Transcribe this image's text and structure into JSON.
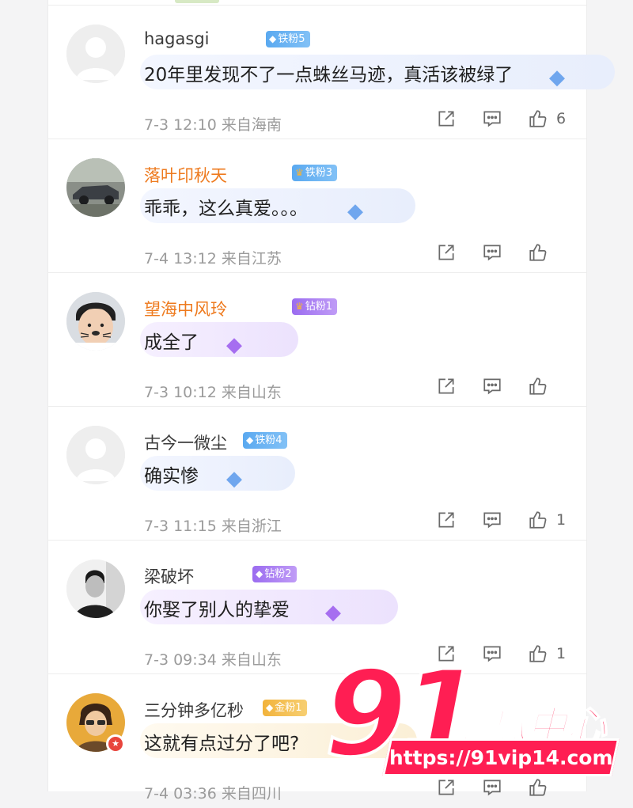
{
  "comments": [
    {
      "username": "hagasgi",
      "badge": {
        "label": "铁粉5",
        "style": "blue",
        "gem": "◆"
      },
      "text": "20年里发现不了一点蛛丝马迹，真活该被绿了",
      "meta": "7-3 12:10  来自海南",
      "likes": "6",
      "avatar": "default-avatar",
      "name_color": "#3a3a3a",
      "bubble_style": "blue"
    },
    {
      "username": "落叶印秋天",
      "badge": {
        "label": "铁粉3",
        "style": "blue",
        "gem": "♛"
      },
      "text": "乖乖，这么真爱。。。",
      "meta": "7-4 13:12  来自江苏",
      "likes": "",
      "avatar": "car-avatar",
      "name_color": "#ee7a1e",
      "bubble_style": "blue"
    },
    {
      "username": "望海中风玲",
      "badge": {
        "label": "钻粉1",
        "style": "purple",
        "gem": "♛"
      },
      "text": "成全了",
      "meta": "7-3 10:12  来自山东",
      "likes": "",
      "avatar": "child-avatar",
      "name_color": "#ee7a1e",
      "bubble_style": "purple"
    },
    {
      "username": "古今一微尘",
      "badge": {
        "label": "铁粉4",
        "style": "blue",
        "gem": "◆"
      },
      "text": "确实惨",
      "meta": "7-3 11:15  来自浙江",
      "likes": "1",
      "avatar": "default-avatar",
      "name_color": "#3a3a3a",
      "bubble_style": "blue"
    },
    {
      "username": "梁破坏",
      "badge": {
        "label": "钻粉2",
        "style": "purple",
        "gem": "◆"
      },
      "text": "你娶了别人的挚爱",
      "meta": "7-3 09:34  来自山东",
      "likes": "1",
      "avatar": "man-avatar",
      "name_color": "#3a3a3a",
      "bubble_style": "purple"
    },
    {
      "username": "三分钟多亿秒",
      "badge": {
        "label": "金粉1",
        "style": "gold",
        "gem": "◆"
      },
      "text": "这就有点过分了吧?",
      "meta": "7-4 03:36  来自四川",
      "likes": "",
      "avatar": "cartoon-avatar",
      "name_color": "#3a3a3a",
      "bubble_style": "gold",
      "verified": "★"
    }
  ],
  "watermark": {
    "number": "91",
    "brand": "吃瓜中心",
    "url": "https://91vip14.com",
    "color": "#ff1e53"
  },
  "icons": {
    "share": "share-icon",
    "comment": "comment-icon",
    "like": "thumbs-up-icon",
    "gem": "diamond-icon"
  }
}
